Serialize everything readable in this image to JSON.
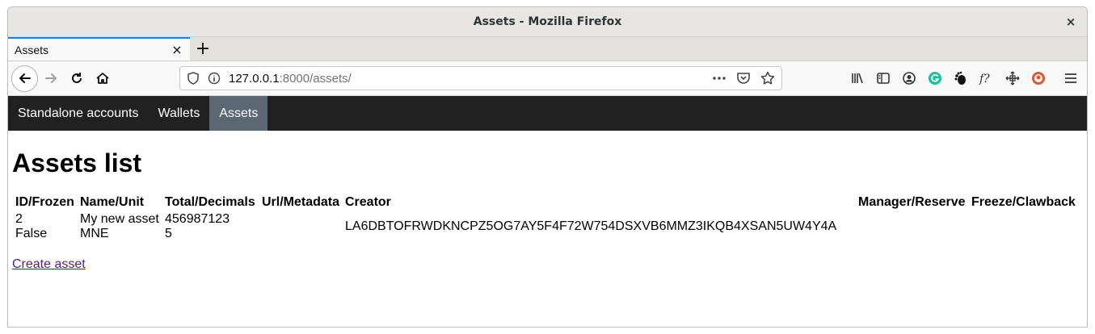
{
  "window": {
    "title": "Assets - Mozilla Firefox",
    "close": "×"
  },
  "tabs": [
    {
      "label": "Assets",
      "close": "×"
    }
  ],
  "newtab": "+",
  "url": {
    "host": "127.0.0.1",
    "rest": ":8000/assets/"
  },
  "nav": {
    "items": [
      "Standalone accounts",
      "Wallets",
      "Assets"
    ],
    "active": "Assets"
  },
  "page": {
    "title": "Assets list",
    "columns": [
      "ID/Frozen",
      "Name/Unit",
      "Total/Decimals",
      "Url/Metadata",
      "Creator",
      "Manager/Reserve",
      "Freeze/Clawback"
    ],
    "rows": [
      {
        "id": "2",
        "frozen": "False",
        "name": "My new asset",
        "unit": "MNE",
        "total": "456987123",
        "decimals": "5",
        "url": "",
        "metadata": "",
        "creator": "LA6DBTOFRWDKNCPZ5OG7AY5F4F72W754DSXVB6MMZ3IKQB4XSAN5UW4Y4A",
        "manager": "",
        "reserve": "",
        "freeze": "",
        "clawback": ""
      }
    ],
    "create_link": "Create asset"
  },
  "colors": {
    "accent": "#0a84ff",
    "navbar": "#212121",
    "nav_active": "#5b6771",
    "visited_link": "#551a8b"
  }
}
